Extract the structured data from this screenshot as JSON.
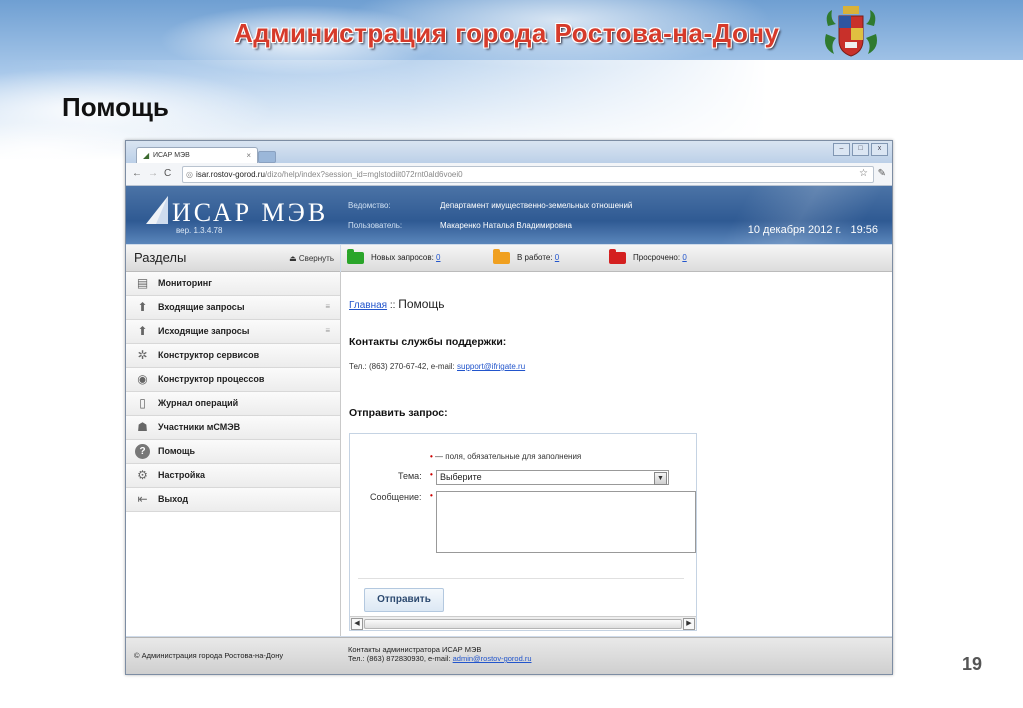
{
  "slide": {
    "title": "Администрация города Ростова-на-Дону",
    "heading": "Помощь",
    "page_number": "19"
  },
  "browser": {
    "tab_title": "ИСАР МЭВ",
    "tab_close": "×",
    "url_host": "isar.rostov-gorod.ru",
    "url_path": "/dizo/help/index?session_id=mglstodiit072rnt0ald6voei0",
    "window_buttons": [
      "–",
      "□",
      "x"
    ]
  },
  "app": {
    "logo": "ИСАР МЭВ",
    "version": "вер. 1.3.4.78",
    "department_label": "Ведомство:",
    "department_value": "Департамент имущественно-земельных отношений",
    "user_label": "Пользователь:",
    "user_value": "Макаренко Наталья Владимировна",
    "date": "10 декабря 2012 г.",
    "time": "19:56"
  },
  "sidebar": {
    "title": "Разделы",
    "collapse_label": "Свернуть",
    "items": [
      {
        "label": "Мониторинг",
        "icon": "monitor-icon"
      },
      {
        "label": "Входящие запросы",
        "icon": "inbox-icon",
        "expandable": true
      },
      {
        "label": "Исходящие запросы",
        "icon": "outbox-icon",
        "expandable": true
      },
      {
        "label": "Конструктор сервисов",
        "icon": "gear-icon"
      },
      {
        "label": "Конструктор процессов",
        "icon": "process-icon"
      },
      {
        "label": "Журнал операций",
        "icon": "journal-icon"
      },
      {
        "label": "Участники мСМЭВ",
        "icon": "users-icon"
      },
      {
        "label": "Помощь",
        "icon": "help-icon"
      },
      {
        "label": "Настройка",
        "icon": "settings-icon"
      },
      {
        "label": "Выход",
        "icon": "exit-icon"
      }
    ]
  },
  "status": {
    "new_label": "Новых запросов:",
    "new_count": "0",
    "new_color": "#2aa52a",
    "work_label": "В работе:",
    "work_count": "0",
    "work_color": "#f0a020",
    "overdue_label": "Просрочено:",
    "overdue_count": "0",
    "overdue_color": "#d42020"
  },
  "content": {
    "breadcrumb_home": "Главная",
    "breadcrumb_sep": " :: ",
    "breadcrumb_current": "Помощь",
    "support_heading": "Контакты службы поддержки:",
    "support_phone": "Тел.: (863) 270-67-42, e-mail: ",
    "support_email": "support@ifrigate.ru",
    "request_heading": "Отправить запрос:",
    "required_note": " — поля, обязательные для заполнения",
    "topic_label": "Тема:",
    "topic_value": "Выберите",
    "message_label": "Сообщение:",
    "send_button": "Отправить"
  },
  "footer": {
    "copyright": "© Администрация города Ростова-на-Дону",
    "admin_contacts": "Контакты администратора ИСАР МЭВ",
    "admin_phone": "Тел.: (863) 872830930, e-mail: ",
    "admin_email": "admin@rostov-gorod.ru"
  }
}
